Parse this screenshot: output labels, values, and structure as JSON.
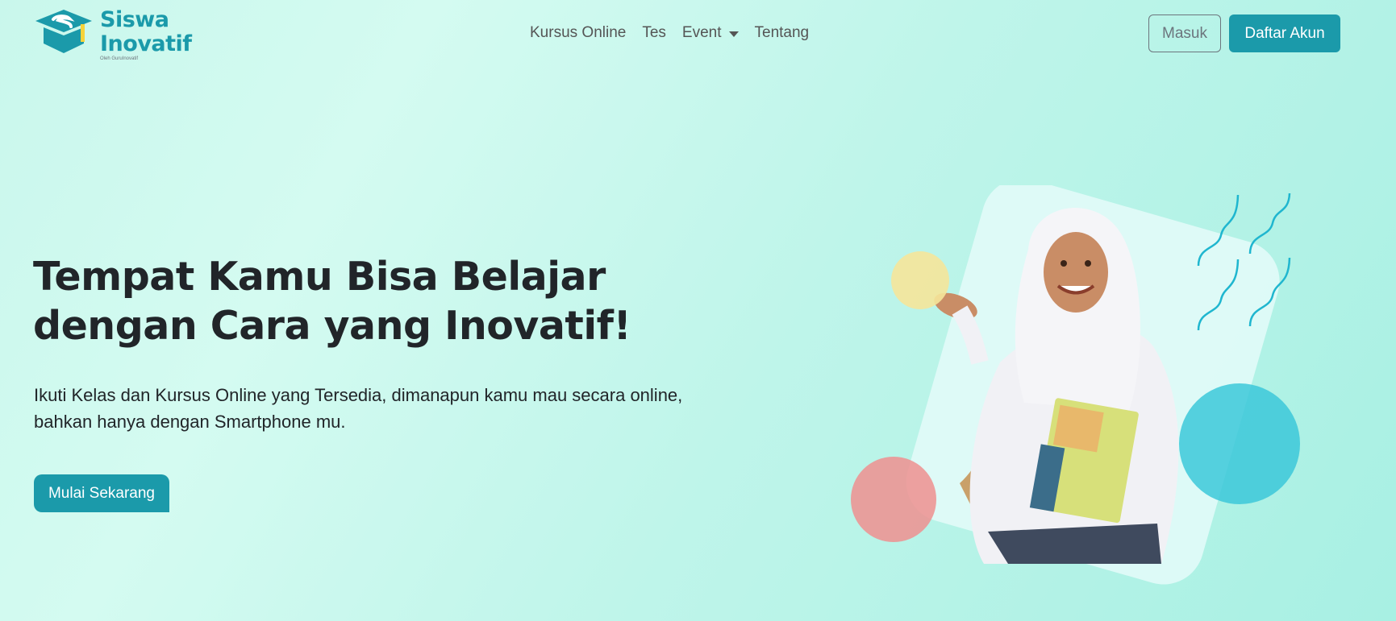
{
  "brand": {
    "line1": "Siswa",
    "line2": "Inovatif",
    "sub": "Oleh GuruInovatif",
    "color": "#1b9aaa",
    "accent": "#f6d33a"
  },
  "nav": {
    "items": [
      {
        "label": "Kursus Online"
      },
      {
        "label": "Tes"
      },
      {
        "label": "Event",
        "has_dropdown": true
      },
      {
        "label": "Tentang"
      }
    ],
    "login_label": "Masuk",
    "register_label": "Daftar Akun"
  },
  "hero": {
    "title": "Tempat Kamu Bisa Belajar dengan Cara yang Inovatif!",
    "description": "Ikuti Kelas dan Kursus Online yang Tersedia, dimanapun kamu mau secara online, bahkan hanya dengan Smartphone mu.",
    "cta_label": "Mulai Sekarang"
  },
  "illustration": {
    "subject": "student-with-hijab-holding-books",
    "colors": {
      "yellow_circle": "#f5e59a",
      "red_circle": "#ef8f8f",
      "cyan_circle": "#3cc8d9",
      "waves": "#1fb6cf"
    }
  }
}
